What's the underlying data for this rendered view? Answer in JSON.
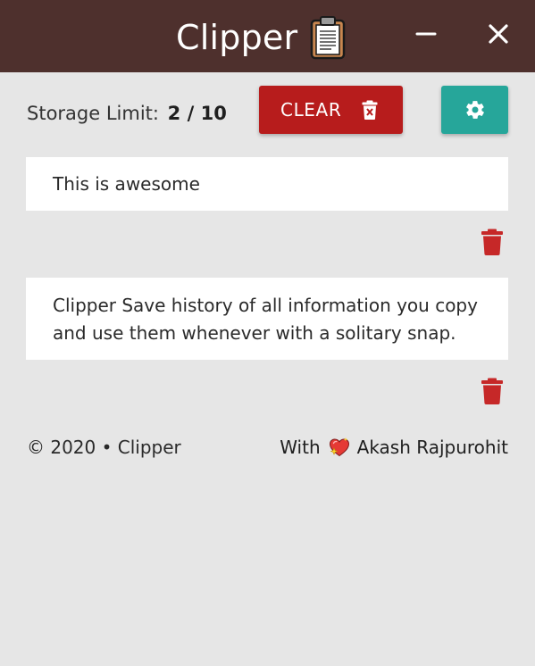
{
  "window": {
    "title": "Clipper",
    "title_icon": "clipboard-icon",
    "controls": [
      "minimize-icon",
      "close-icon"
    ]
  },
  "toolbar": {
    "storage_label": "Storage Limit:",
    "storage_count": "2 / 10",
    "clear_label": "CLEAR",
    "clear_icon": "trash-x-icon",
    "settings_icon": "gear-icon"
  },
  "clips": [
    {
      "text": "This is awesome",
      "delete_icon": "trash-icon"
    },
    {
      "text": "Clipper Save history of all information you copy and use them whenever with a solitary snap.",
      "delete_icon": "trash-icon"
    }
  ],
  "footer": {
    "copyright": "© 2020 • Clipper",
    "with_label": "With",
    "heart_icon": "sparkling-heart-icon",
    "author": "Akash Rajpurohit"
  },
  "colors": {
    "titlebar": "#4e302d",
    "background": "#e6e6e6",
    "clear_button": "#b71c1c",
    "settings_button": "#26a69a",
    "trash_icon": "#c62828"
  }
}
